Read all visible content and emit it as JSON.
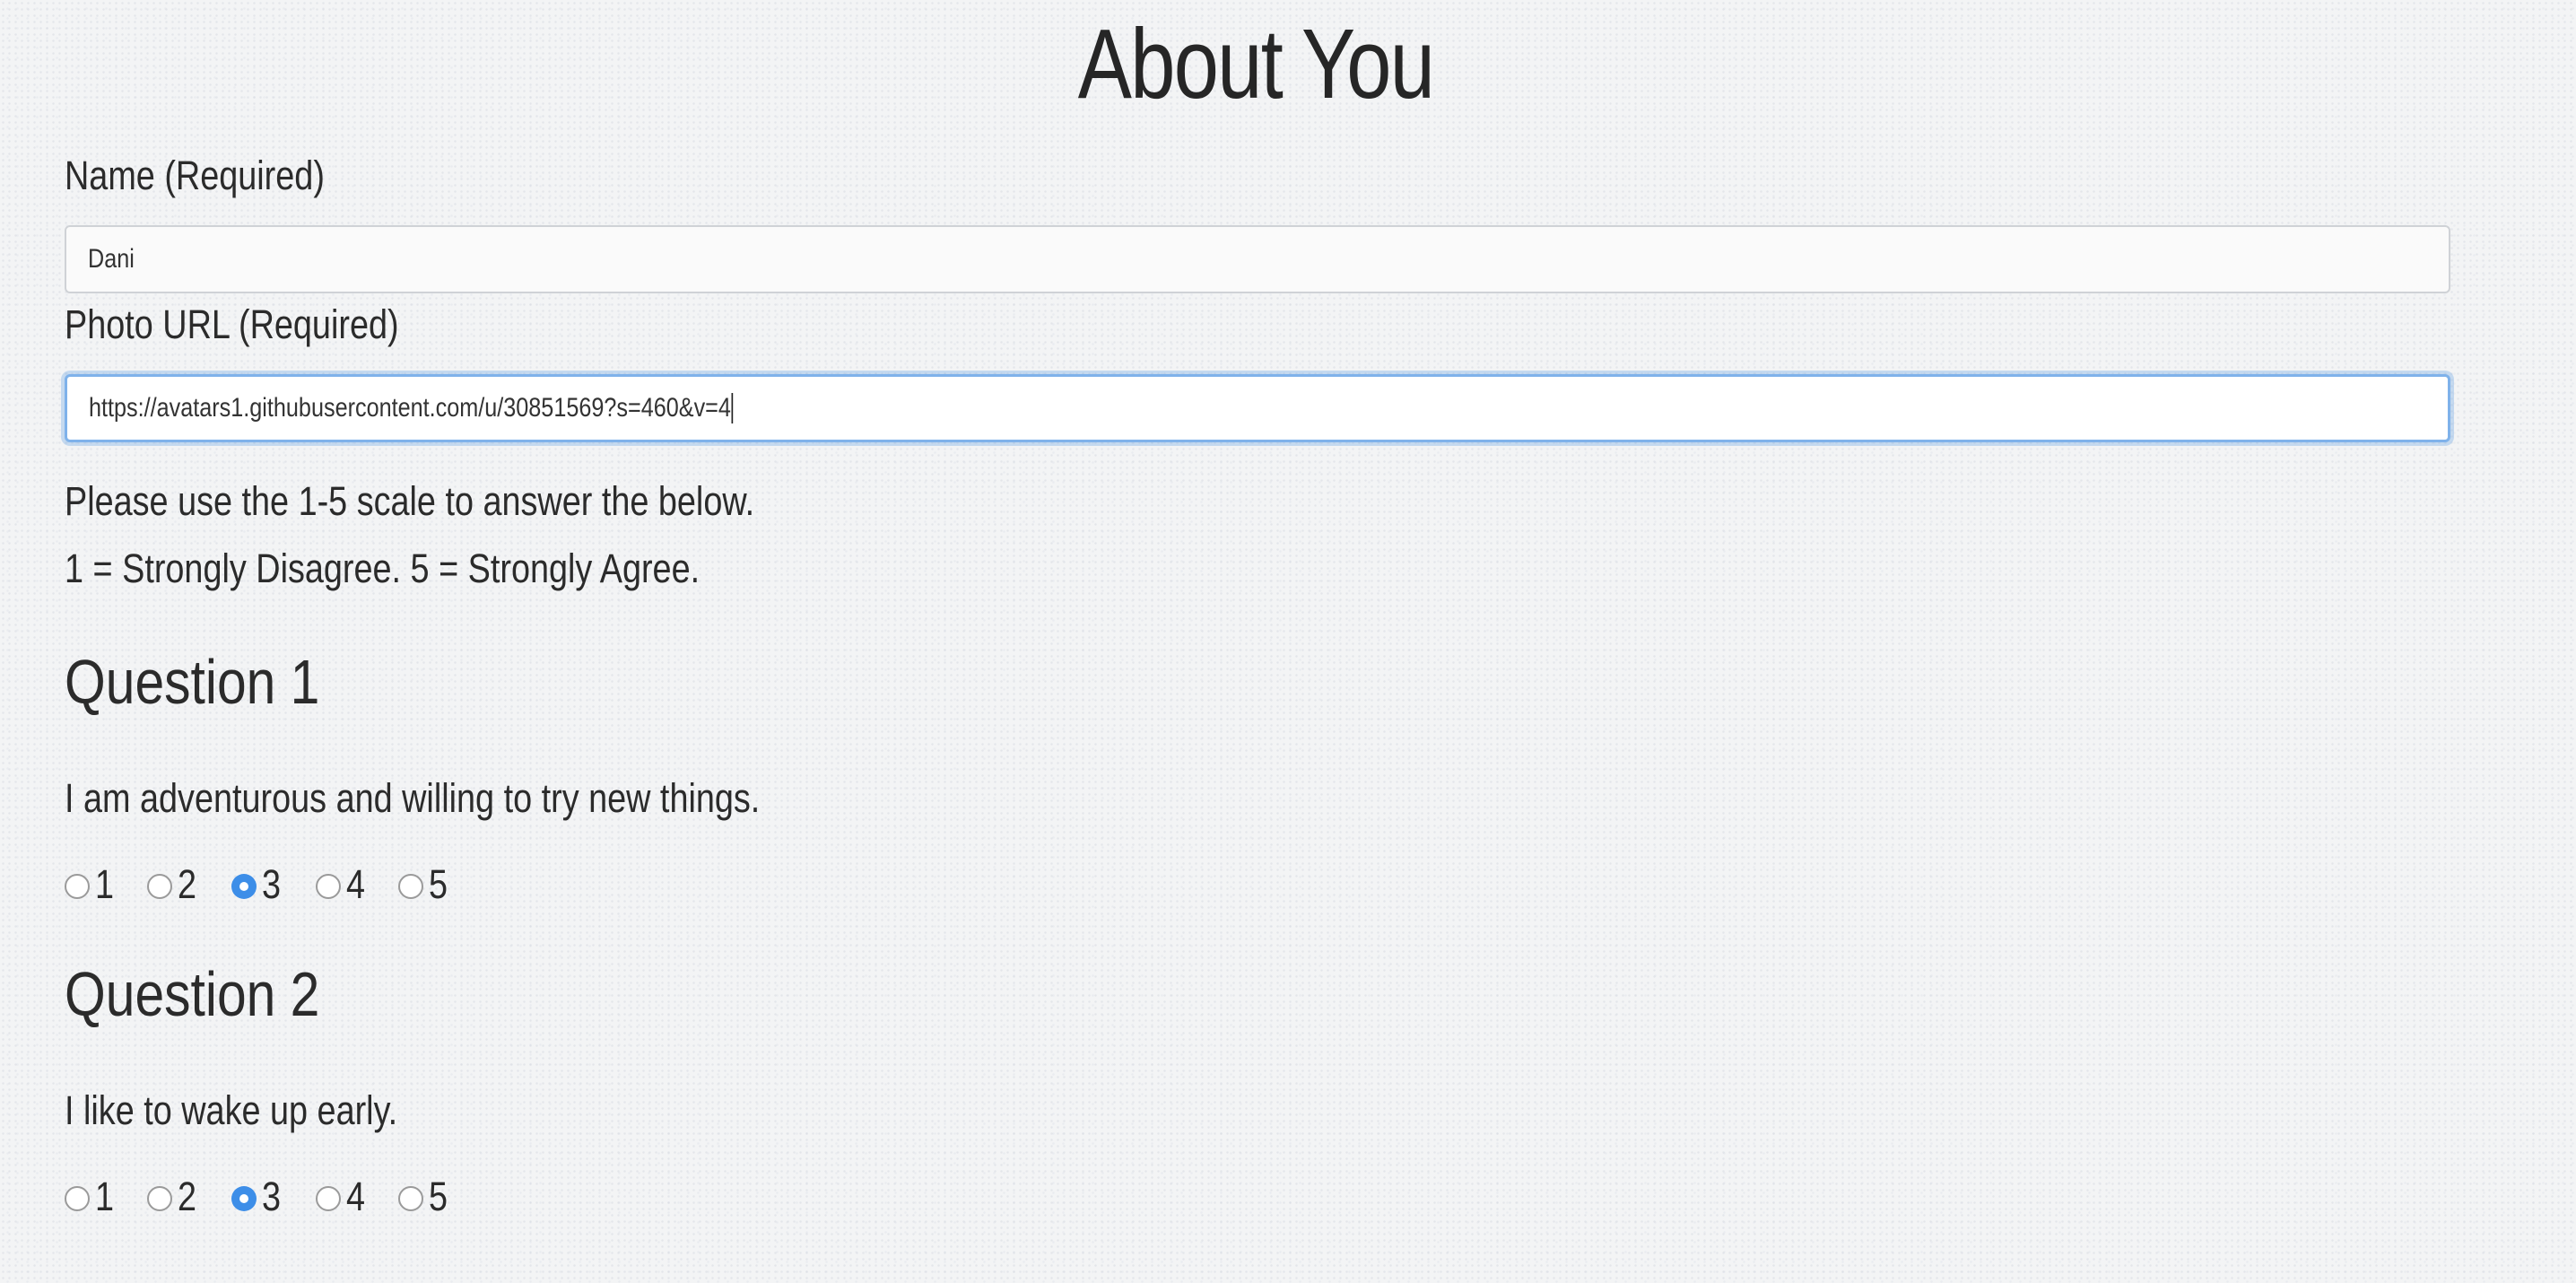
{
  "page": {
    "title": "About You"
  },
  "form": {
    "name": {
      "label": "Name (Required)",
      "value": "Dani"
    },
    "photo": {
      "label": "Photo URL (Required)",
      "value": "https://avatars1.githubusercontent.com/u/30851569?s=460&v=4"
    },
    "instructions": [
      "Please use the 1-5 scale to answer the below.",
      "1 = Strongly Disagree. 5 = Strongly Agree."
    ]
  },
  "questions": [
    {
      "heading": "Question 1",
      "text": "I am adventurous and willing to try new things.",
      "options": [
        "1",
        "2",
        "3",
        "4",
        "5"
      ],
      "selected": "3"
    },
    {
      "heading": "Question 2",
      "text": "I like to wake up early.",
      "options": [
        "1",
        "2",
        "3",
        "4",
        "5"
      ],
      "selected": "3"
    }
  ],
  "colors": {
    "radio_checked": "#3d8ee8",
    "focus_ring": "#7fb2ea"
  }
}
